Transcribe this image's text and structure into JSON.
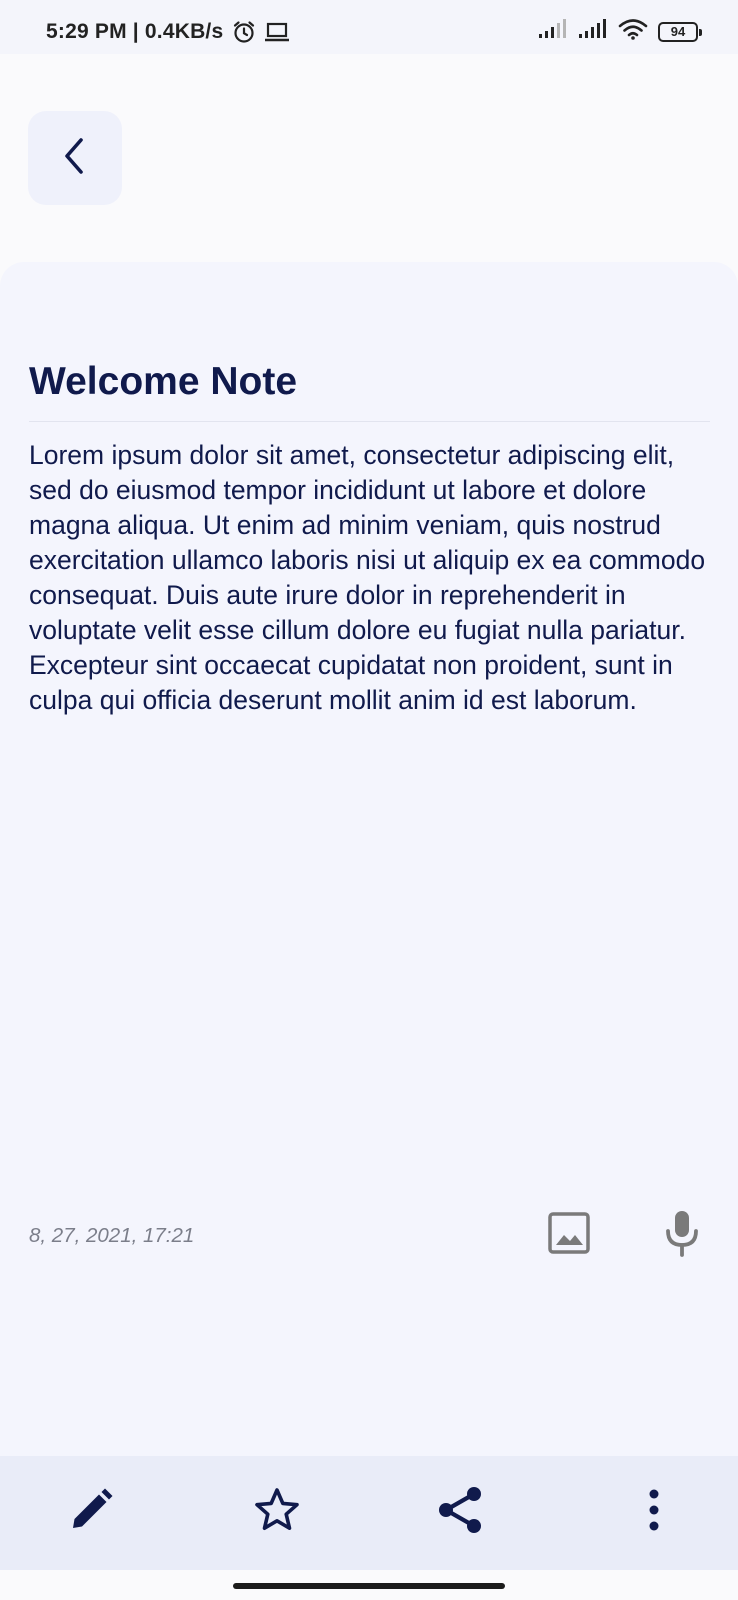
{
  "status_bar": {
    "time": "5:29 PM | 0.4KB/s",
    "battery": "94",
    "icons": [
      "alarm-icon",
      "laptop-icon",
      "signal-icon",
      "signal-icon",
      "wifi-icon",
      "battery-icon"
    ]
  },
  "header": {
    "back_icon": "chevron-left-icon"
  },
  "note": {
    "title": "Welcome Note",
    "body": "Lorem ipsum dolor sit amet, consectetur adipiscing elit, sed do eiusmod tempor incididunt ut labore et dolore magna aliqua. Ut enim ad minim veniam, quis nostrud exercitation ullamco laboris nisi ut aliquip ex ea commodo consequat. Duis aute irure dolor in reprehenderit in voluptate velit esse cillum dolore eu fugiat nulla pariatur. Excepteur sint occaecat cupidatat non proident, sunt in culpa qui officia deserunt mollit anim id est laborum.",
    "date": "8, 27, 2021, 17:21",
    "attach_icons": [
      "image-icon",
      "microphone-icon"
    ]
  },
  "toolbar": {
    "icons": [
      "pencil-icon",
      "star-icon",
      "share-icon",
      "more-vertical-icon"
    ]
  },
  "colors": {
    "title": "#101a4c",
    "sheet": "#f4f5fd",
    "toolbar": "#e9ecf8",
    "muted_icon": "#7a7a7a"
  }
}
